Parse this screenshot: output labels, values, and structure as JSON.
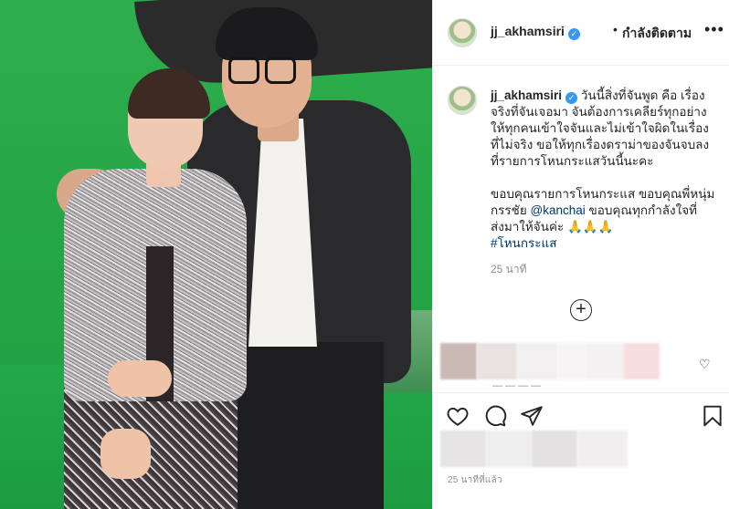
{
  "post": {
    "username": "jj_akhamsiri",
    "verified_icon": "verified-badge-icon",
    "follow_separator": "•",
    "follow_status": "กำลังติดตาม",
    "more_label": "•••"
  },
  "caption": {
    "username": "jj_akhamsiri",
    "lines": [
      "วันนี้สิ่งที่จันพูด คือ เรื่อง",
      "จริงที่จันเจอมา จันต้องการเคลียร์ทุกอย่าง",
      "ให้ทุกคนเข้าใจจันและไม่เข้าใจผิดในเรื่อง",
      "ที่ไม่จริง ขอให้ทุกเรื่องดราม่าของจันจบลง",
      "ที่รายการโหนกระแสวันนี้นะคะ"
    ],
    "paragraph2_line1": "ขอบคุณรายการโหนกระแส ขอบคุณพี่หนุ่ม",
    "paragraph2_line2_prefix": "กรรชัย ",
    "mention": "@kanchai",
    "paragraph2_line2_suffix": " ขอบคุณทุกกำลังใจที่",
    "paragraph2_line3": "ส่งมาให้จันค่ะ 🙏🙏🙏",
    "hashtag": "#โหนกระแส",
    "time_ago": "25 นาที"
  },
  "load_more_icon": "plus-circle-icon",
  "comment_heart_icon": "heart-outline-icon",
  "actions": {
    "like_icon": "heart-icon",
    "comment_icon": "comment-icon",
    "share_icon": "share-icon",
    "save_icon": "bookmark-icon"
  },
  "footer": {
    "post_time": "25 นาทีที่แล้ว"
  },
  "colors": {
    "link": "#00376b",
    "secondary_text": "#8e8e8e",
    "verified": "#3897f0",
    "green_screen": "#25a646"
  }
}
